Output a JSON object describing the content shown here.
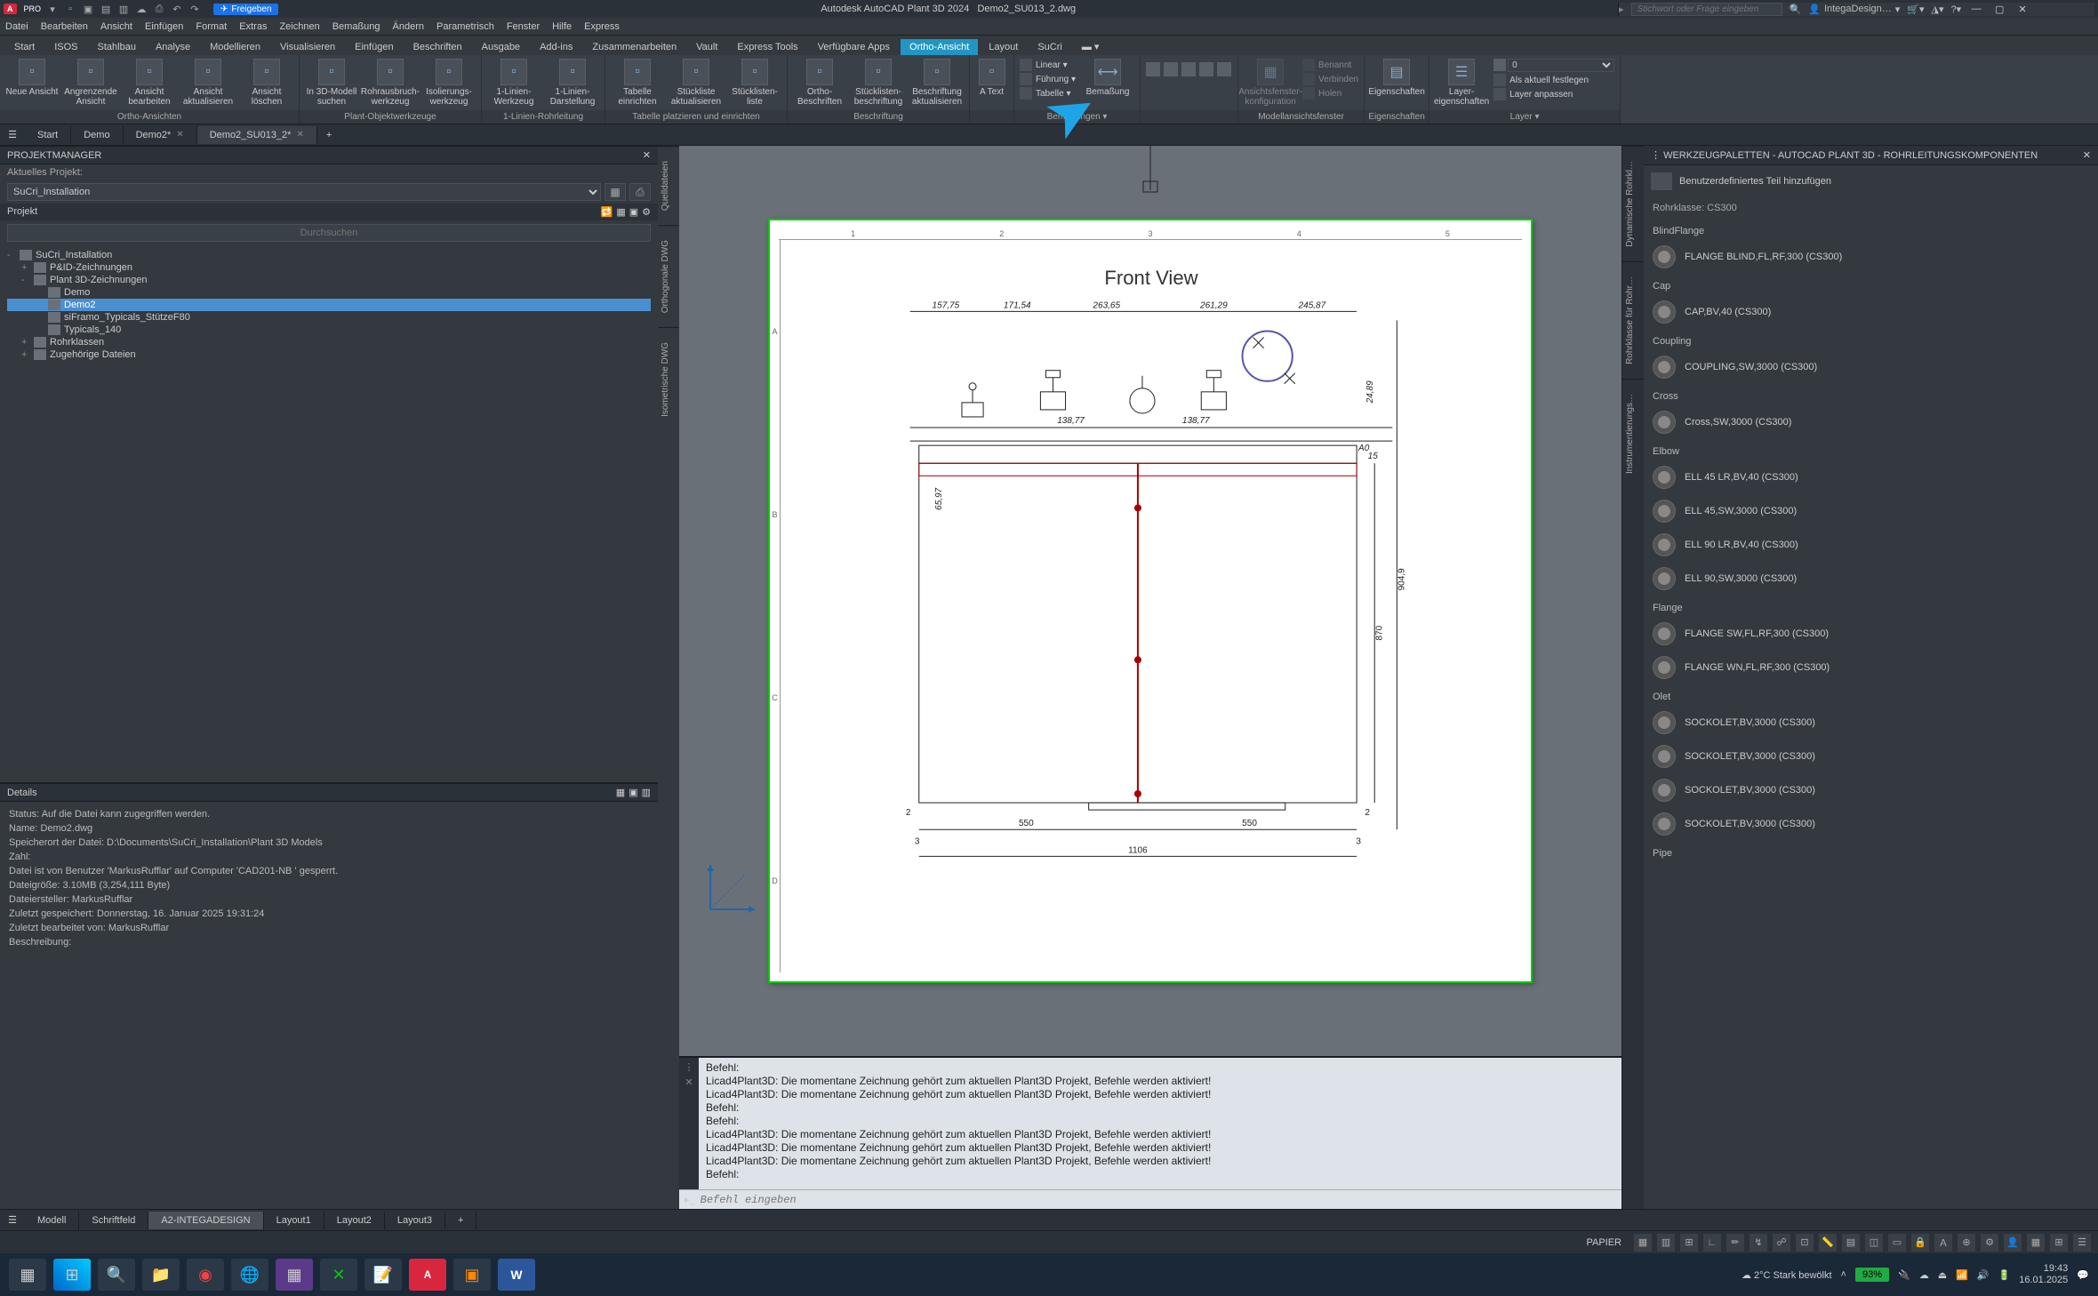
{
  "app": {
    "title_prefix": "Autodesk AutoCAD Plant 3D 2024",
    "doc": "Demo2_SU013_2.dwg",
    "logo": "A",
    "pro": "PRO",
    "share": "Freigeben",
    "search_placeholder": "Stichwort oder Frage eingeben",
    "user": "IntegaDesign…"
  },
  "menu": [
    "Datei",
    "Bearbeiten",
    "Ansicht",
    "Einfügen",
    "Format",
    "Extras",
    "Zeichnen",
    "Bemaßung",
    "Ändern",
    "Parametrisch",
    "Fenster",
    "Hilfe",
    "Express"
  ],
  "ribbon_tabs": [
    "Start",
    "ISOS",
    "Stahlbau",
    "Analyse",
    "Modellieren",
    "Visualisieren",
    "Einfügen",
    "Beschriften",
    "Ausgabe",
    "Add-ins",
    "Zusammenarbeiten",
    "Vault",
    "Express Tools",
    "Verfügbare Apps",
    "Ortho-Ansicht",
    "Layout",
    "SuCri"
  ],
  "ribbon_active": "Ortho-Ansicht",
  "ribbon_panels": {
    "p1": {
      "title": "Ortho-Ansichten",
      "b": [
        "Neue Ansicht",
        "Angrenzende Ansicht",
        "Ansicht bearbeiten",
        "Ansicht aktualisieren",
        "Ansicht löschen"
      ]
    },
    "p2": {
      "title": "Plant-Objektwerkzeuge",
      "b": [
        "In 3D-Modell suchen",
        "Rohrausbruch-werkzeug",
        "Isolierungs-werkzeug"
      ]
    },
    "p3": {
      "title": "1-Linien-Rohrleitung",
      "b": [
        "1-Linien-Werkzeug",
        "1-Linien-Darstellung"
      ]
    },
    "p4": {
      "title": "Tabelle platzieren und einrichten",
      "b": [
        "Tabelle einrichten",
        "Stückliste aktualisieren",
        "Stücklisten-liste"
      ]
    },
    "p5": {
      "title": "Beschriftung",
      "b": [
        "Ortho-Beschriften",
        "Stücklisten-beschriftung",
        "Beschriftung aktualisieren"
      ]
    },
    "p6": {
      "title": "",
      "b": [
        "A Text"
      ]
    },
    "p7": {
      "title": "Bemaßungen",
      "s": [
        "Linear",
        "Führung",
        "Tabelle"
      ],
      "b2": "Bemaßung"
    },
    "p8": {
      "title": "Modellansichtsfenster",
      "b": [
        "Ansichtsfenster-konfiguration"
      ],
      "s": [
        "Benannt",
        "Verbinden",
        "Holen"
      ]
    },
    "p9": {
      "title": "Eigenschaften",
      "b": [
        "Eigenschaften"
      ]
    },
    "p10": {
      "title": "Layer",
      "b": [
        "Layer-eigenschaften"
      ],
      "s": [
        "Als aktuell festlegen",
        "Layer anpassen"
      ]
    }
  },
  "doc_tabs": [
    "Start",
    "Demo",
    "Demo2*",
    "Demo2_SU013_2*"
  ],
  "doc_active": 3,
  "pm": {
    "title": "PROJEKTMANAGER",
    "label": "Aktuelles Projekt:",
    "selected": "SuCri_Installation",
    "proj_label": "Projekt",
    "search": "Durchsuchen",
    "tree": [
      {
        "l": 0,
        "exp": "-",
        "t": "SuCri_Installation"
      },
      {
        "l": 1,
        "exp": "+",
        "t": "P&ID-Zeichnungen"
      },
      {
        "l": 1,
        "exp": "-",
        "t": "Plant 3D-Zeichnungen"
      },
      {
        "l": 2,
        "exp": "",
        "t": "Demo"
      },
      {
        "l": 2,
        "exp": "",
        "t": "Demo2",
        "sel": true
      },
      {
        "l": 2,
        "exp": "",
        "t": "siFramo_Typicals_StützeF80"
      },
      {
        "l": 2,
        "exp": "",
        "t": "Typicals_140"
      },
      {
        "l": 1,
        "exp": "+",
        "t": "Rohrklassen"
      },
      {
        "l": 1,
        "exp": "+",
        "t": "Zugehörige Dateien"
      }
    ]
  },
  "details": {
    "title": "Details",
    "lines": [
      "Status: Auf die Datei kann zugegriffen werden.",
      "Name: Demo2.dwg",
      "Speicherort der Datei: D:\\Documents\\SuCri_Installation\\Plant 3D Models",
      "Zahl:",
      "Datei ist von Benutzer 'MarkusRufflar' auf Computer 'CAD201-NB ' gesperrt.",
      "Dateigröße: 3.10MB (3,254,111 Byte)",
      "Dateiersteller: MarkusRufflar",
      "Zuletzt gespeichert: Donnerstag, 16. Januar 2025 19:31:24",
      "Zuletzt bearbeitet von: MarkusRufflar",
      "Beschreibung:"
    ]
  },
  "vtabs": [
    "Quelldateien",
    "Orthogonale DWG",
    "Isometrische DWG"
  ],
  "drawing": {
    "title": "Front View",
    "dims_top": [
      "157,75",
      "171,54",
      "263,65",
      "261,29",
      "245,87"
    ],
    "dims": {
      "h1": "550",
      "h2": "550",
      "w": "1106",
      "v1": "870",
      "v2": "904,9",
      "s": "65,97",
      "p": "138,77",
      "r1": "2",
      "r2": "2",
      "ab": "24,89",
      "fi": "15",
      "h0": "A0",
      "n1": "3",
      "n2": "3"
    },
    "ruler_h": [
      "1",
      "2",
      "3",
      "4",
      "5"
    ],
    "ruler_v": [
      "A",
      "B",
      "C",
      "D"
    ]
  },
  "cmd": {
    "lines": [
      "Befehl:",
      "Licad4Plant3D: Die momentane Zeichnung gehört zum aktuellen Plant3D Projekt, Befehle werden aktiviert!",
      "Licad4Plant3D: Die momentane Zeichnung gehört zum aktuellen Plant3D Projekt, Befehle werden aktiviert!",
      "Befehl:",
      "Befehl:",
      "Licad4Plant3D: Die momentane Zeichnung gehört zum aktuellen Plant3D Projekt, Befehle werden aktiviert!",
      "Licad4Plant3D: Die momentane Zeichnung gehört zum aktuellen Plant3D Projekt, Befehle werden aktiviert!",
      "Licad4Plant3D: Die momentane Zeichnung gehört zum aktuellen Plant3D Projekt, Befehle werden aktiviert!",
      "Befehl:"
    ],
    "prompt": "Befehl eingeben"
  },
  "palette": {
    "title": "WERKZEUGPALETTEN - AUTOCAD PLANT 3D - ROHRLEITUNGSKOMPONENTEN",
    "add": "Benutzerdefiniertes Teil hinzufügen",
    "klass": "Rohrklasse: CS300",
    "vside": [
      "Dynamische Rohrkl…",
      "Rohrklasse für Rohr…",
      "Instrumentierungs…"
    ],
    "cats": [
      {
        "n": "BlindFlange",
        "items": [
          "FLANGE BLIND,FL,RF,300 (CS300)"
        ]
      },
      {
        "n": "Cap",
        "items": [
          "CAP,BV,40 (CS300)"
        ]
      },
      {
        "n": "Coupling",
        "items": [
          "COUPLING,SW,3000 (CS300)"
        ]
      },
      {
        "n": "Cross",
        "items": [
          "Cross,SW,3000 (CS300)"
        ]
      },
      {
        "n": "Elbow",
        "items": [
          "ELL 45 LR,BV,40 (CS300)",
          "ELL 45,SW,3000 (CS300)",
          "ELL 90 LR,BV,40 (CS300)",
          "ELL 90,SW,3000 (CS300)"
        ]
      },
      {
        "n": "Flange",
        "items": [
          "FLANGE SW,FL,RF,300 (CS300)",
          "FLANGE WN,FL,RF,300 (CS300)"
        ]
      },
      {
        "n": "Olet",
        "items": [
          "SOCKOLET,BV,3000 (CS300)",
          "SOCKOLET,BV,3000 (CS300)",
          "SOCKOLET,BV,3000 (CS300)",
          "SOCKOLET,BV,3000 (CS300)"
        ]
      },
      {
        "n": "Pipe",
        "items": []
      }
    ]
  },
  "layout_tabs": [
    "Modell",
    "Schriftfeld",
    "A2-INTEGADESIGN",
    "Layout1",
    "Layout2",
    "Layout3"
  ],
  "layout_active": 2,
  "status": {
    "paper": "PAPIER"
  },
  "taskbar": {
    "weather": "2°C Stark bewölkt",
    "battery": "93%",
    "time": "19:43",
    "date": "16.01.2025"
  }
}
